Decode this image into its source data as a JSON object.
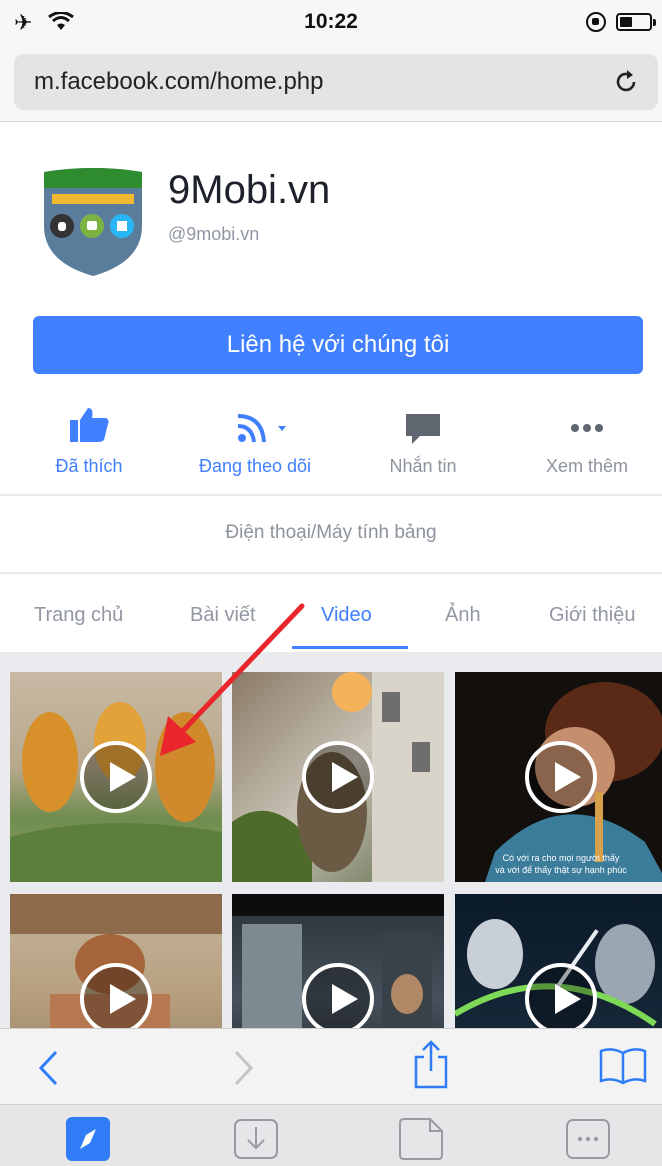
{
  "status_bar": {
    "time": "10:22"
  },
  "browser": {
    "url": "m.facebook.com/home.php"
  },
  "page": {
    "name": "9Mobi.vn",
    "handle": "@9mobi.vn",
    "contact_label": "Liên hệ với chúng tôi",
    "category": "Điện thoại/Máy tính bảng"
  },
  "actions": [
    {
      "label": "Đã thích",
      "icon": "like-icon"
    },
    {
      "label": "Đang theo dõi",
      "icon": "follow-rss-icon"
    },
    {
      "label": "Nhắn tin",
      "icon": "message-icon"
    },
    {
      "label": "Xem thêm",
      "icon": "more-icon"
    }
  ],
  "tabs": [
    {
      "label": "Trang chủ"
    },
    {
      "label": "Bài viết"
    },
    {
      "label": "Video",
      "active": true
    },
    {
      "label": "Ảnh"
    },
    {
      "label": "Giới thiệu"
    }
  ],
  "videos": [
    {
      "caption": ""
    },
    {
      "caption": ""
    },
    {
      "caption": "Có với ra cho mọi người thấy\nvà với để thấy thật sự hạnh phúc"
    },
    {
      "caption": ""
    },
    {
      "caption": ""
    },
    {
      "caption": ""
    }
  ],
  "colors": {
    "accent": "#4080ff",
    "arrow": "#e8262b"
  }
}
